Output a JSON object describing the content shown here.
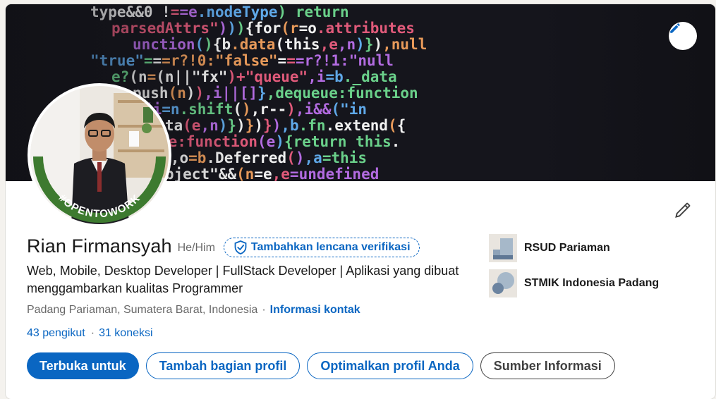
{
  "banner": {
    "code_lines": [
      "type&&0 !==e.nodeType) return",
      "parsedAttrs\"))){for(r=o.attributes",
      "unction(){b.data(this,e,n)}),null",
      "\"true\"===r?!0:\"false\"===r?!1:\"null",
      "e?(n=(n||\"fx\")+\"queue\",i=b._data",
      "push(n)),i||[]},dequeue:function",
      "===i&&(i=n.shift(),r--),i&&(\"in",
      "moveData(e,n)})})}),b.fn.extend({",
      "queue:function(e){return this.",
      "var r,i=1,o=b.Deferred(),a=this",
      "lse==object\"&&(n=e,e=undefined"
    ],
    "edit_icon": "pencil-icon"
  },
  "avatar": {
    "badge_text": "#OPENTOWORK"
  },
  "profile": {
    "name": "Rian Firmansyah",
    "pronouns": "He/Him",
    "verify_label": "Tambahkan lencana verifikasi",
    "headline": "Web, Mobile, Desktop Developer | FullStack Developer | Aplikasi yang dibuat menggambarkan kualitas Programmer",
    "location": "Padang Pariaman, Sumatera Barat, Indonesia",
    "location_separator": "·",
    "contact_link": "Informasi kontak",
    "followers": "43 pengikut",
    "stats_separator": "·",
    "connections": "31 koneksi"
  },
  "actions": {
    "open_to": "Terbuka untuk",
    "add_section": "Tambah bagian profil",
    "optimize": "Optimalkan profil Anda",
    "resources": "Sumber Informasi"
  },
  "orgs": [
    {
      "name": "RSUD Pariaman",
      "icon": "company-logo"
    },
    {
      "name": "STMIK Indonesia Padang",
      "icon": "school-logo"
    }
  ],
  "colors": {
    "accent": "#0a66c2",
    "open_to_work_green": "#3d7a2f"
  }
}
